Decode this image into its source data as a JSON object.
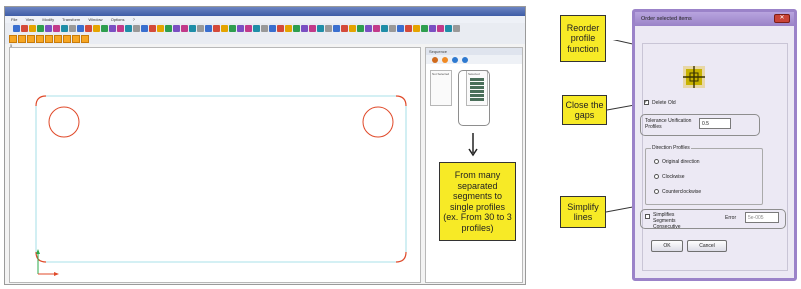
{
  "cad_window": {
    "menu": [
      "File",
      "View",
      "Modify",
      "Transform",
      "Window",
      "Options",
      "?"
    ],
    "canvas_tab": "5",
    "panel_title": "Sequence",
    "subpanel_left_label": "Not Selected",
    "subpanel_right_label": "Selected"
  },
  "callouts": {
    "reorder": "Reorder profile function",
    "close_gaps": "Close the gaps",
    "simplify": "Simplify lines",
    "many_segments": "From many separated segments to single profiles (ex. From 30 to 3 profiles)"
  },
  "dialog": {
    "title": "Order selected items",
    "close_glyph": "✕",
    "delete_old": "Delete Old",
    "tolerance_label": "Tolerance Unification Profiles",
    "tolerance_value": "0.5",
    "direction_group": "Direction Profiles",
    "radio_original": "Original direction",
    "radio_clockwise": "Clockwise",
    "radio_counter": "Counterclockwise",
    "simplify_label": "Simplifies Segments Consecutive",
    "error_label": "Error",
    "error_value": "5e-005",
    "ok_label": "OK",
    "cancel_label": "Cancel"
  },
  "colors": {
    "accent_yellow": "#f7ea26",
    "profile_red": "#e04a2a",
    "profile_cyan": "#8fd8e2",
    "dialog_border": "#9b83c9",
    "toolbar_orange": "#f6a623"
  }
}
